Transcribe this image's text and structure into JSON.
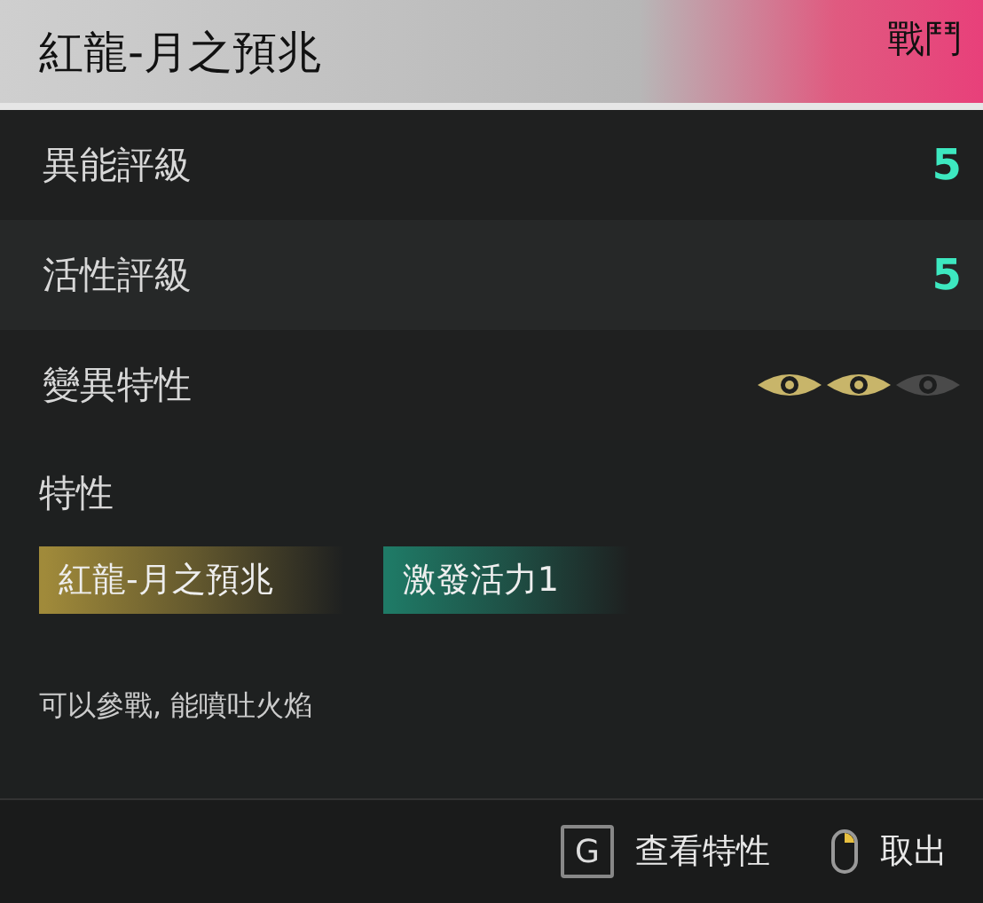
{
  "header": {
    "title": "紅龍-月之預兆",
    "category": "戰鬥"
  },
  "stats": [
    {
      "label": "異能評級",
      "value": "5"
    },
    {
      "label": "活性評級",
      "value": "5"
    }
  ],
  "mutation": {
    "label": "變異特性",
    "eyes": [
      {
        "on": true
      },
      {
        "on": true
      },
      {
        "on": false
      }
    ]
  },
  "traits": {
    "heading": "特性",
    "tags": [
      {
        "label": "紅龍-月之預兆",
        "color": "#a08a3a"
      },
      {
        "label": "激發活力1",
        "color": "#1f7a66"
      }
    ],
    "description": "可以參戰, 能噴吐火焰"
  },
  "footer": [
    {
      "kind": "key",
      "key": "G",
      "label": "查看特性"
    },
    {
      "kind": "mouse",
      "label": "取出"
    }
  ]
}
